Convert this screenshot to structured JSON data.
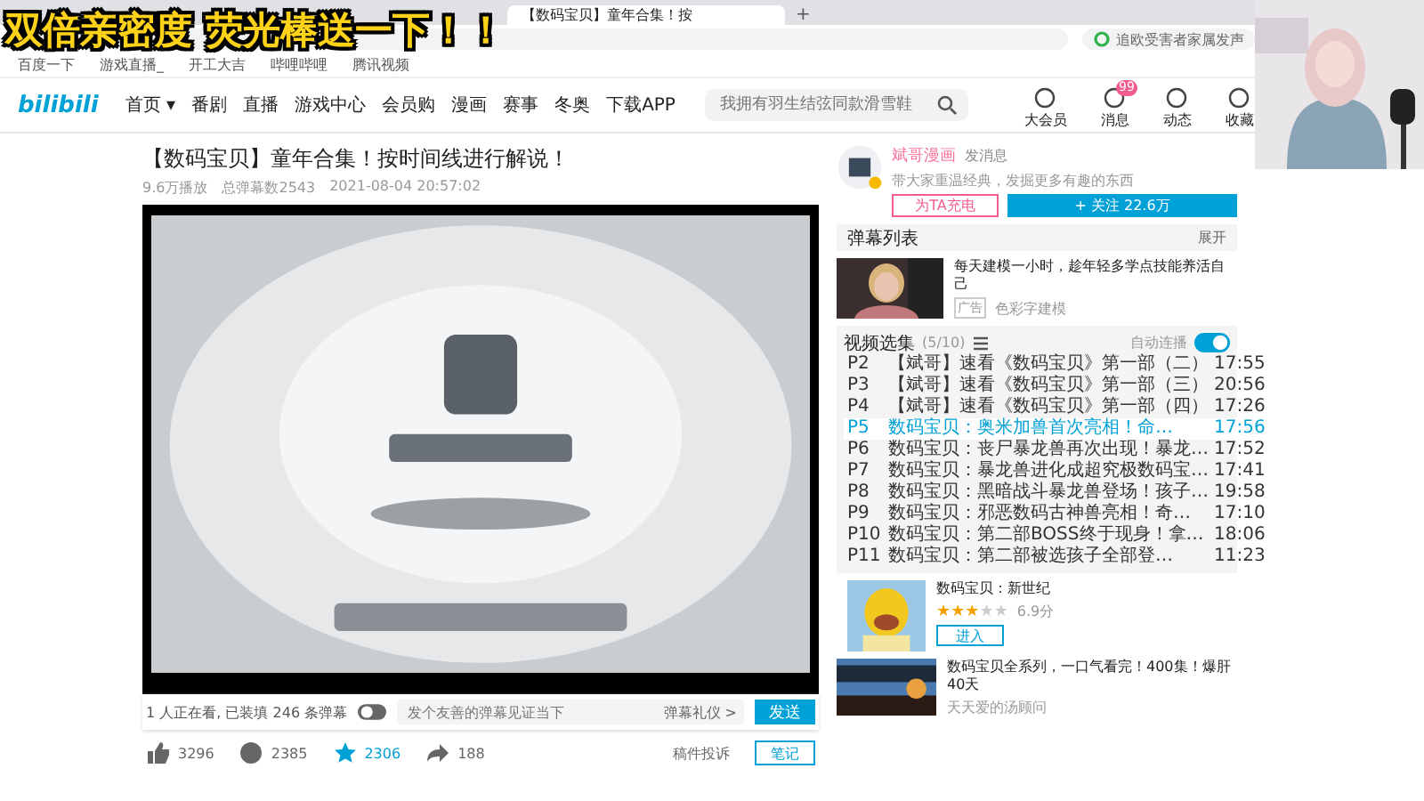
{
  "overlay_banner": "双倍亲密度 荧光棒送一下！！",
  "browser": {
    "tab_title": "【数码宝贝】童年合集！按",
    "new_tab": "+",
    "address_search": "追欧受害者家属发声",
    "bookmarks": [
      "百度一下",
      "游戏直播_",
      "开工大吉",
      "哔哩哔哩",
      "腾讯视频"
    ]
  },
  "nav": {
    "logo": "bilibili",
    "items": [
      "首页 ▾",
      "番剧",
      "直播",
      "游戏中心",
      "会员购",
      "漫画",
      "赛事",
      "冬奥",
      "下载APP"
    ],
    "search_placeholder": "我拥有羽生结弦同款滑雪鞋",
    "icons": [
      {
        "label": "大会员"
      },
      {
        "label": "消息",
        "badge": "99"
      },
      {
        "label": "动态"
      },
      {
        "label": "收藏"
      }
    ]
  },
  "video": {
    "title": "【数码宝贝】童年合集！按时间线进行解说！",
    "meta": [
      "9.6万播放",
      "总弹幕数2543",
      "2021-08-04 20:57:02"
    ],
    "watching": "1 人正在看, 已装填 246 条弹幕",
    "danmaku_placeholder": "发个友善的弹幕见证当下",
    "etiquette": "弹幕礼仪 >",
    "send": "发送",
    "actions": [
      {
        "kind": "like",
        "count": "3296",
        "active": false
      },
      {
        "kind": "coin",
        "count": "2385",
        "active": false
      },
      {
        "kind": "fav",
        "count": "2306",
        "active": true
      },
      {
        "kind": "share",
        "count": "188",
        "active": false
      }
    ],
    "report": "稿件投诉",
    "note": "笔记"
  },
  "uploader": {
    "name": "斌哥漫画",
    "message": "发消息",
    "desc": "带大家重温经典，发掘更多有趣的东西",
    "charge": "为TA充电",
    "follow": "+ 关注 22.6万"
  },
  "danmaku_list": {
    "title": "弹幕列表",
    "expand": "展开"
  },
  "ad": {
    "text": "每天建模一小时，趁年轻多学点技能养活自己",
    "tag": "广告",
    "source": "色彩字建模"
  },
  "playlist": {
    "title": "视频选集",
    "count": "(5/10)",
    "autoplay_label": "自动连播",
    "autoplay": true,
    "items": [
      {
        "part": "P2",
        "title": "【斌哥】速看《数码宝贝》第一部（二）",
        "duration": "17:55",
        "selected": false
      },
      {
        "part": "P3",
        "title": "【斌哥】速看《数码宝贝》第一部（三）",
        "duration": "20:56",
        "selected": false
      },
      {
        "part": "P4",
        "title": "【斌哥】速看《数码宝贝》第一部（四）",
        "duration": "17:26",
        "selected": false
      },
      {
        "part": "P5",
        "title": "数码宝贝：奥米加兽首次亮相！命…",
        "duration": "17:56",
        "selected": true
      },
      {
        "part": "P6",
        "title": "数码宝贝：丧尸暴龙兽再次出现！暴龙…",
        "duration": "17:52",
        "selected": false
      },
      {
        "part": "P7",
        "title": "数码宝贝：暴龙兽进化成超究极数码宝…",
        "duration": "17:41",
        "selected": false
      },
      {
        "part": "P8",
        "title": "数码宝贝：黑暗战斗暴龙兽登场！孩子…",
        "duration": "19:58",
        "selected": false
      },
      {
        "part": "P9",
        "title": "数码宝贝：邪恶数码古神兽亮相！奇…",
        "duration": "17:10",
        "selected": false
      },
      {
        "part": "P10",
        "title": "数码宝贝：第二部BOSS终于现身！拿…",
        "duration": "18:06",
        "selected": false
      },
      {
        "part": "P11",
        "title": "数码宝贝：第二部被选孩子全部登…",
        "duration": "11:23",
        "selected": false
      }
    ]
  },
  "recommend": [
    {
      "title": "数码宝贝：新世纪",
      "stars": 3,
      "score": "6.9分",
      "button": "进入"
    },
    {
      "title": "数码宝贝全系列，一口气看完！400集！爆肝40天",
      "author": "天天爱的汤顾问"
    }
  ]
}
